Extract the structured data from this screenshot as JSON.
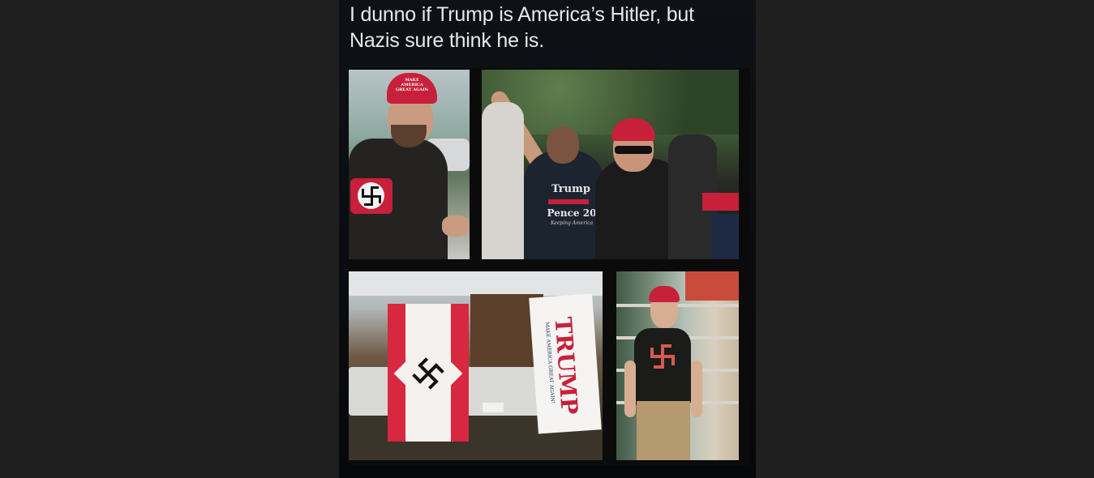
{
  "post": {
    "caption_line1": "I dunno if Trump is America’s Hitler, but",
    "caption_line2": "Nazis sure think he is."
  },
  "photos": [
    {
      "cap_text": "MAKE AMERICA GREAT AGAIN"
    },
    {
      "shirt_text_1": "Trump",
      "shirt_text_2": "Pence 20",
      "shirt_text_3": "Keeping America"
    },
    {
      "banner_text": "TRUMP",
      "banner_subtext": "MAKE AMERICA GREAT AGAIN!"
    },
    {
      "cap_text": ""
    }
  ],
  "colors": {
    "background": "#1f1f1f",
    "card": "#0a0d11",
    "caption": "#e8e8e8",
    "maga_red": "#c8203a"
  }
}
